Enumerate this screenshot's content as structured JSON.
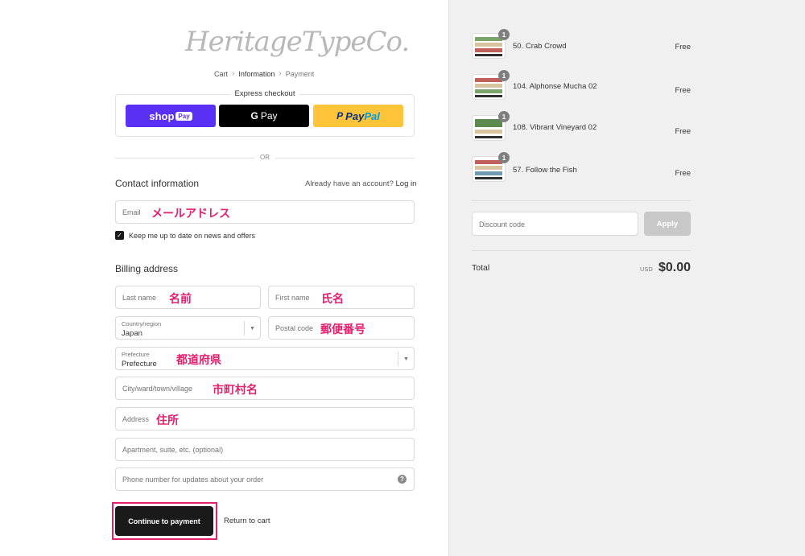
{
  "brand": {
    "logo_text": "HeritageTypeCo."
  },
  "breadcrumb": {
    "items": [
      "Cart",
      "Information",
      "Payment"
    ],
    "separator": "›"
  },
  "express_checkout": {
    "title": "Express checkout",
    "shop_pay": {
      "label": "shop",
      "pill": "Pay",
      "color": "#5a31f4"
    },
    "google_pay": {
      "g": "G",
      "label": "Pay"
    },
    "paypal": {
      "label_a": "Pay",
      "label_b": "Pal",
      "color": "#ffc439"
    }
  },
  "divider_or": "OR",
  "contact": {
    "title": "Contact information",
    "login_prompt": "Already have an account?",
    "login_link": "Log in",
    "email": {
      "placeholder": "Email",
      "annotation": "メールアドレス"
    },
    "newsletter": {
      "checked": true,
      "label": "Keep me up to date on news and offers"
    }
  },
  "billing": {
    "title": "Billing address",
    "last_name": {
      "placeholder": "Last name",
      "annotation": "名前"
    },
    "first_name": {
      "placeholder": "First name",
      "annotation": "氏名"
    },
    "country": {
      "label": "Country/region",
      "value": "Japan"
    },
    "postal_code": {
      "placeholder": "Postal code",
      "annotation": "郵便番号"
    },
    "prefecture": {
      "label": "Prefecture",
      "value": "Prefecture",
      "annotation": "都道府県"
    },
    "city": {
      "placeholder": "City/ward/town/village",
      "annotation": "市町村名"
    },
    "address": {
      "placeholder": "Address",
      "annotation": "住所"
    },
    "apartment": {
      "placeholder": "Apartment, suite, etc. (optional)"
    },
    "phone": {
      "placeholder": "Phone number for updates about your order",
      "help_icon": "?"
    }
  },
  "actions": {
    "continue": "Continue to payment",
    "return": "Return to cart"
  },
  "order_summary": {
    "items": [
      {
        "qty": "1",
        "name": "50. Crab Crowd",
        "price": "Free"
      },
      {
        "qty": "1",
        "name": "104. Alphonse Mucha 02",
        "price": "Free"
      },
      {
        "qty": "1",
        "name": "108. Vibrant Vineyard 02",
        "price": "Free"
      },
      {
        "qty": "1",
        "name": "57. Follow the Fish",
        "price": "Free"
      }
    ],
    "discount": {
      "placeholder": "Discount code",
      "apply_label": "Apply"
    },
    "total": {
      "label": "Total",
      "currency": "USD",
      "value": "$0.00"
    }
  },
  "colors": {
    "annotation": "#e4206e",
    "primary_button": "#1a1a1a",
    "sidebar_bg": "#f0f0f0"
  }
}
